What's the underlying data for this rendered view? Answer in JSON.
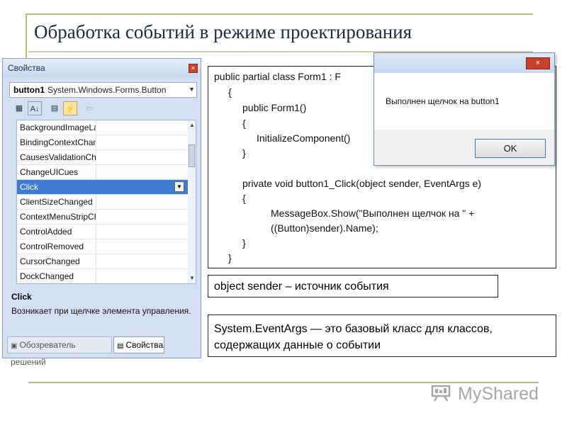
{
  "slide": {
    "title": "Обработка событий в режиме проектирования"
  },
  "properties_panel": {
    "title": "Свойства",
    "close_glyph": "×",
    "object_name": "button1",
    "object_type": "System.Windows.Forms.Button",
    "rows": [
      {
        "name": "BackgroundImageLay"
      },
      {
        "name": "BindingContextChan"
      },
      {
        "name": "CausesValidationCha"
      },
      {
        "name": "ChangeUICues"
      },
      {
        "name": "Click"
      },
      {
        "name": "ClientSizeChanged"
      },
      {
        "name": "ContextMenuStripCh"
      },
      {
        "name": "ControlAdded"
      },
      {
        "name": "ControlRemoved"
      },
      {
        "name": "CursorChanged"
      },
      {
        "name": "DockChanged"
      }
    ],
    "selected_row": "Click",
    "description_title": "Click",
    "description_text": "Возникает при щелчке элемента управления.",
    "tab_solution": "Обозреватель решений",
    "tab_properties": "Свойства"
  },
  "code": {
    "lines": [
      "public partial class Form1 : F",
      "{",
      "public Form1()",
      "{",
      "InitializeComponent()",
      "}",
      "private void button1_Click(object sender, EventArgs e)",
      "{",
      "MessageBox.Show(\"Выполнен щелчок на \" +",
      "((Button)sender).Name);",
      "}",
      "}"
    ]
  },
  "message_box": {
    "close_glyph": "×",
    "text": "Выполнен щелчок на button1",
    "ok_label": "OK"
  },
  "notes": {
    "sender": "object sender – источник события",
    "event_args": "System.EventArgs — это базовый класс для классов, содержащих данные о событии"
  },
  "logo": {
    "text": "MyShared"
  },
  "colors": {
    "selected_row": "#3f7cd1",
    "title_rule": "#c9b57a",
    "close_button": "#c8422b"
  }
}
